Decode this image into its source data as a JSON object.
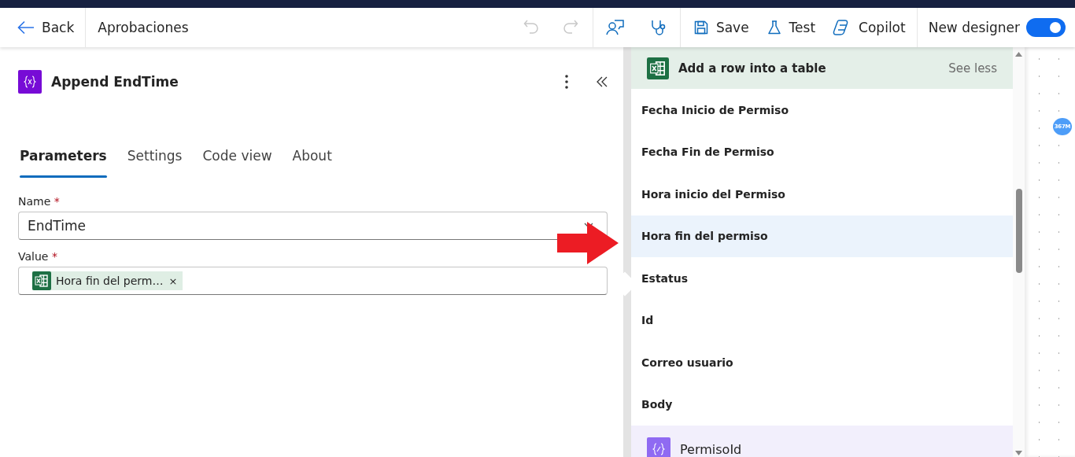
{
  "toolbar": {
    "back": "Back",
    "flow_name": "Aprobaciones",
    "undo_disabled": true,
    "redo_disabled": true,
    "buttons": [
      {
        "kind": "save",
        "label": "Save"
      },
      {
        "kind": "test",
        "label": "Test"
      },
      {
        "kind": "copilot",
        "label": "Copilot"
      }
    ],
    "new_designer": {
      "label": "New designer",
      "on": true
    }
  },
  "panel": {
    "title": "Append EndTime",
    "tabs": [
      {
        "label": "Parameters",
        "selected": true
      },
      {
        "label": "Settings",
        "selected": false
      },
      {
        "label": "Code view",
        "selected": false
      },
      {
        "label": "About",
        "selected": false
      }
    ],
    "fields": [
      {
        "kind": "text",
        "label": "Name",
        "required_mark": "*",
        "value": "EndTime"
      },
      {
        "kind": "token",
        "label": "Value",
        "required_mark": "*",
        "token": "Hora fin del perm…",
        "remove": "×"
      }
    ]
  },
  "dynamic_content": {
    "group": {
      "title": "Add a row into a table",
      "action": "See less"
    },
    "items": [
      {
        "label": "Fecha Inicio de Permiso",
        "selected": false
      },
      {
        "label": "Fecha Fin de Permiso",
        "selected": false
      },
      {
        "label": "Hora inicio del Permiso",
        "selected": false
      },
      {
        "label": "Hora fin del permiso",
        "selected": true
      },
      {
        "label": "Estatus",
        "selected": false
      },
      {
        "label": "Id",
        "selected": false
      },
      {
        "label": "Correo usuario",
        "selected": false
      },
      {
        "label": "Body",
        "selected": false
      }
    ],
    "next_group": {
      "title": "PermisoId"
    }
  },
  "canvas": {
    "badge": "367M"
  }
}
